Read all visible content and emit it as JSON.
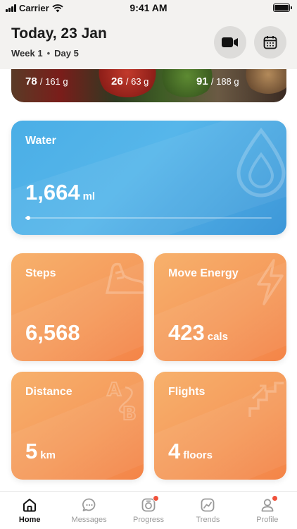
{
  "status_bar": {
    "carrier": "Carrier",
    "time": "9:41 AM"
  },
  "header": {
    "title": "Today, 23 Jan",
    "week": "Week 1",
    "separator": "•",
    "day": "Day 5",
    "icons": [
      "video-camera-icon",
      "calendar-icon"
    ]
  },
  "macros": [
    {
      "value": "78",
      "target": "/ 161 g"
    },
    {
      "value": "26",
      "target": "/ 63 g"
    },
    {
      "value": "91",
      "target": "/ 188 g"
    }
  ],
  "water": {
    "label": "Water",
    "value": "1,664",
    "unit": "ml",
    "progress": 0.01,
    "icon": "water-drop-icon"
  },
  "tiles": [
    {
      "label": "Steps",
      "value": "6,568",
      "unit": "",
      "icon": "shoe-icon"
    },
    {
      "label": "Move Energy",
      "value": "423",
      "unit": "cals",
      "icon": "lightning-icon"
    },
    {
      "label": "Distance",
      "value": "5",
      "unit": "km",
      "icon": "a-to-b-icon"
    },
    {
      "label": "Flights",
      "value": "4",
      "unit": "floors",
      "icon": "stairs-icon"
    }
  ],
  "tabbar": [
    {
      "label": "Home",
      "active": true,
      "badge": false,
      "icon": "home-icon"
    },
    {
      "label": "Messages",
      "active": false,
      "badge": false,
      "icon": "message-icon"
    },
    {
      "label": "Progress",
      "active": false,
      "badge": true,
      "icon": "camera-progress-icon"
    },
    {
      "label": "Trends",
      "active": false,
      "badge": false,
      "icon": "trends-icon"
    },
    {
      "label": "Profile",
      "active": false,
      "badge": true,
      "icon": "profile-icon"
    }
  ],
  "colors": {
    "water": "#4aaee6",
    "tile": "#f59b5c",
    "badge": "#f0513b"
  }
}
